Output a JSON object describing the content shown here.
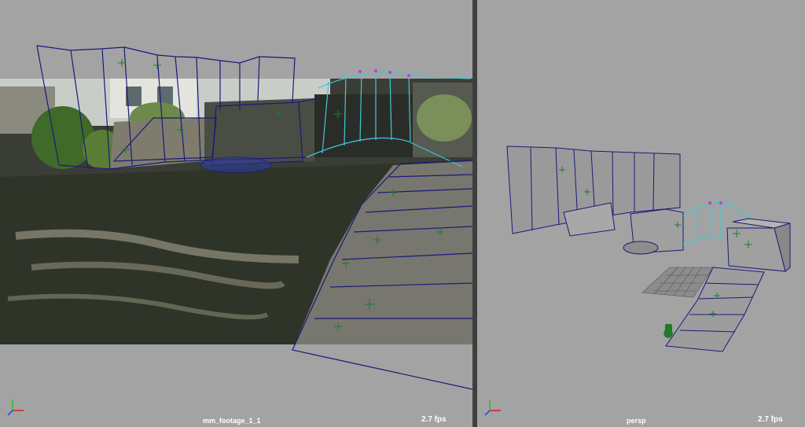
{
  "viewports": {
    "left": {
      "camera_label": "mm_footage_1_1",
      "fps": "2.7 fps"
    },
    "right": {
      "camera_label": "persp",
      "fps": "2.7 fps"
    }
  },
  "colors": {
    "viewport_bg": "#a3a3a3",
    "wire_blue": "#1a1a7a",
    "wire_cyan": "#40c8d8",
    "locator_green": "#1f7a2a",
    "divider": "#3e3e3e"
  },
  "icons": [
    "axis-gizmo-icon"
  ]
}
